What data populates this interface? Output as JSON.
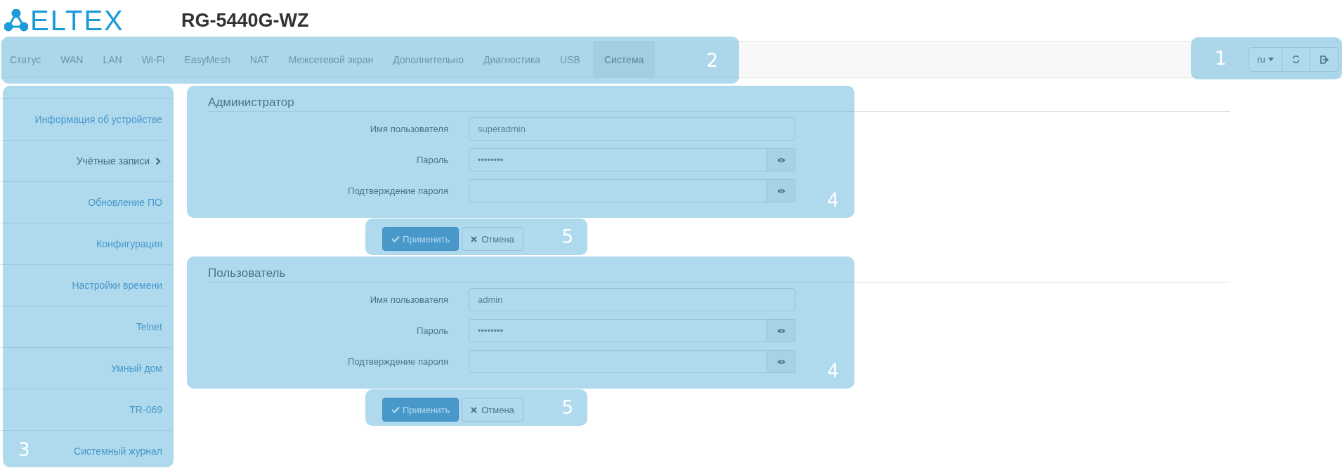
{
  "logo": {
    "text": "ELTEX"
  },
  "device_title": "RG-5440G-WZ",
  "nav": {
    "callout": "2",
    "tabs": [
      {
        "label": "Статус",
        "selected": false
      },
      {
        "label": "WAN",
        "selected": false
      },
      {
        "label": "LAN",
        "selected": false
      },
      {
        "label": "Wi-Fi",
        "selected": false
      },
      {
        "label": "EasyMesh",
        "selected": false
      },
      {
        "label": "NAT",
        "selected": false
      },
      {
        "label": "Межсетевой экран",
        "selected": false
      },
      {
        "label": "Дополнительно",
        "selected": false
      },
      {
        "label": "Диагностика",
        "selected": false
      },
      {
        "label": "USB",
        "selected": false
      },
      {
        "label": "Система",
        "selected": true
      }
    ]
  },
  "toolbar": {
    "callout": "1",
    "language": "ru"
  },
  "sidebar": {
    "callout": "3",
    "items": [
      {
        "label": "Информация об устройстве",
        "selected": false
      },
      {
        "label": "Учётные записи",
        "selected": true
      },
      {
        "label": "Обновление ПО",
        "selected": false
      },
      {
        "label": "Конфигурация",
        "selected": false
      },
      {
        "label": "Настройки времени",
        "selected": false
      },
      {
        "label": "Telnet",
        "selected": false
      },
      {
        "label": "Умный дом",
        "selected": false
      },
      {
        "label": "TR-069",
        "selected": false
      },
      {
        "label": "Системный журнал",
        "selected": false
      }
    ]
  },
  "sections": [
    {
      "title": "Администратор",
      "callout": "4",
      "fields": [
        {
          "label": "Имя пользователя",
          "kind": "text",
          "value": "superadmin"
        },
        {
          "label": "Пароль",
          "kind": "password",
          "value": "••••••••"
        },
        {
          "label": "Подтверждение пароля",
          "kind": "password"
        }
      ],
      "actions": {
        "callout": "5",
        "apply": "Применить",
        "cancel": "Отмена"
      }
    },
    {
      "title": "Пользователь",
      "callout": "4",
      "fields": [
        {
          "label": "Имя пользователя",
          "kind": "text",
          "value": "admin"
        },
        {
          "label": "Пароль",
          "kind": "password",
          "value": "••••••••"
        },
        {
          "label": "Подтверждение пароля",
          "kind": "password"
        }
      ],
      "actions": {
        "callout": "5",
        "apply": "Применить",
        "cancel": "Отмена"
      }
    }
  ]
}
